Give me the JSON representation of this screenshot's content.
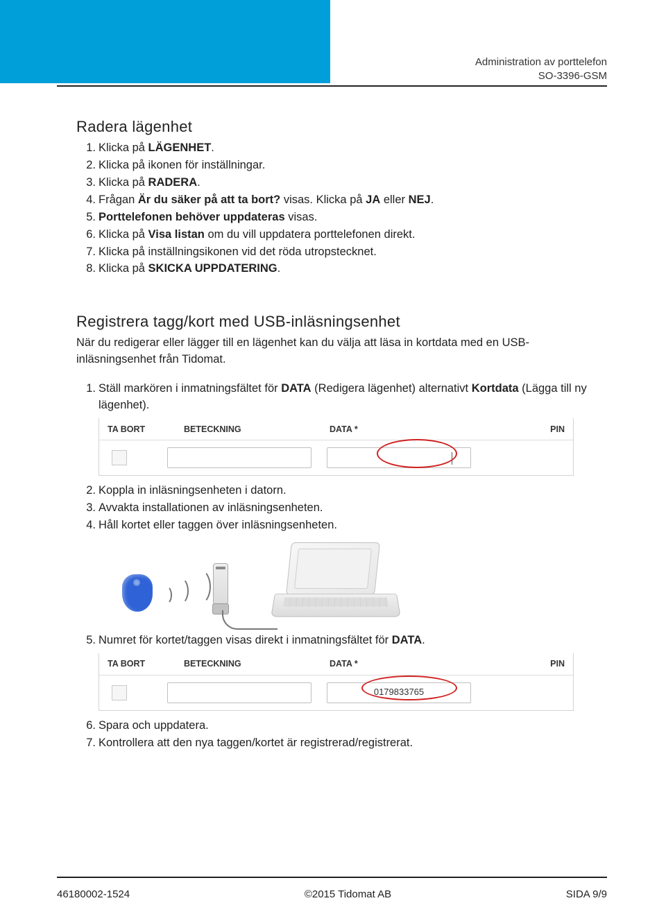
{
  "header": {
    "line1": "Administration av porttelefon",
    "line2": "SO-3396-GSM"
  },
  "section1": {
    "title": "Radera lägenhet",
    "steps": [
      {
        "pre": "Klicka på ",
        "bold": "LÄGENHET",
        "post": "."
      },
      {
        "pre": "Klicka på ikonen för inställningar.",
        "bold": "",
        "post": ""
      },
      {
        "pre": "Klicka på ",
        "bold": "RADERA",
        "post": "."
      },
      {
        "pre": "Frågan ",
        "bold": "Är du säker på att ta bort?",
        "post": " visas. Klicka på ",
        "bold2": "JA",
        "post2": " eller ",
        "bold3": "NEJ",
        "post3": "."
      },
      {
        "bold": "Porttelefonen behöver uppdateras",
        "post": " visas."
      },
      {
        "pre": "Klicka på ",
        "bold": "Visa listan",
        "post": " om du vill uppdatera porttelefonen direkt."
      },
      {
        "pre": "Klicka på inställningsikonen vid det röda utropstecknet.",
        "bold": "",
        "post": ""
      },
      {
        "pre": "Klicka på ",
        "bold": "SKICKA UPPDATERING",
        "post": "."
      }
    ]
  },
  "section2": {
    "title": "Registrera tagg/kort med USB-inläsningsenhet",
    "intro": "När du redigerar eller lägger till en lägenhet kan du välja att läsa in kortdata med en USB-inläsningsenhet från Tidomat.",
    "step1": {
      "pre": "Ställ markören i inmatningsfältet för ",
      "bold1": "DATA",
      "mid": " (Redigera lägenhet) alternativt ",
      "bold2": "Kortdata",
      "post": " (Lägga till ny lägenhet)."
    },
    "tbl": {
      "h1": "TA BORT",
      "h2": "BETECKNING",
      "h3": "DATA *",
      "h4": "PIN",
      "data_value_filled": "0179833765"
    },
    "step2": "Koppla in inläsningsenheten i datorn.",
    "step3": "Avvakta installationen av inläsningsenheten.",
    "step4": "Håll kortet eller taggen över inläsningsenheten.",
    "step5": {
      "pre": "Numret för kortet/taggen visas direkt i inmatningsfältet för ",
      "bold": "DATA",
      "post": "."
    },
    "step6": "Spara och uppdatera.",
    "step7": "Kontrollera att den nya taggen/kortet är registrerad/registrerat."
  },
  "footer": {
    "left": "46180002-1524",
    "center": "©2015 Tidomat AB",
    "right": "SIDA 9/9"
  }
}
